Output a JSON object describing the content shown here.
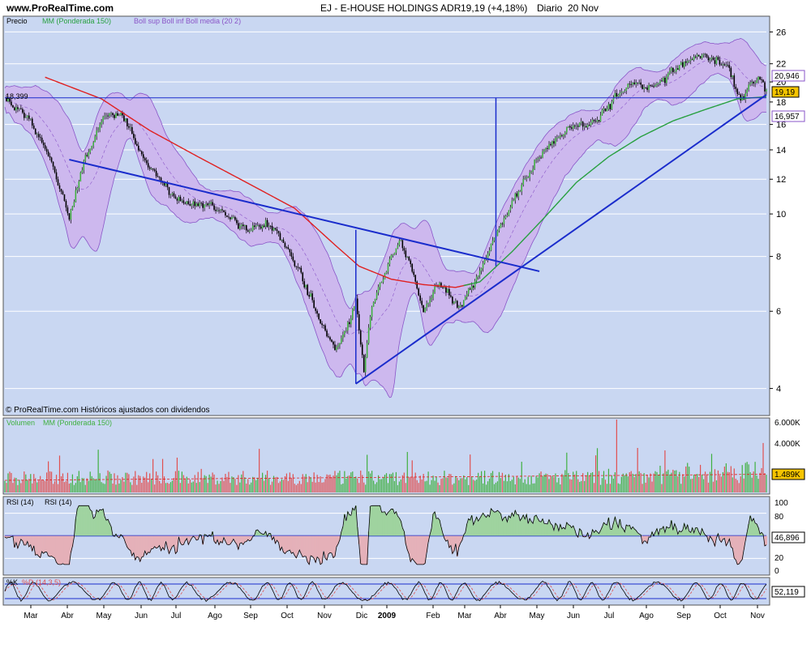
{
  "header": {
    "site": "www.ProRealTime.com",
    "title": "EJ - E-HOUSE HOLDINGS ADR",
    "quote": "19,19 (+4,18%)",
    "period": "Diario",
    "date": "20 Nov"
  },
  "colors": {
    "price_bg": "#c9d7f2",
    "panel_bg": "#c9d7f2",
    "boll_fill": "#cdb8ee",
    "boll_line": "#8a55c8",
    "ma_red": "#e02020",
    "ma_green": "#28a040",
    "trend": "#1a2ccc",
    "vol_green": "#40b040",
    "vol_red": "#e05050",
    "rsi_green": "#9fd39f",
    "rsi_red": "#e5b0b8"
  },
  "chart_data": [
    {
      "type": "line",
      "name": "price",
      "legend": [
        "Precio",
        "MM (Ponderada 150)",
        "Boll sup Boll inf Boll media (20 2)"
      ],
      "note": "© ProRealTime.com Históricos ajustados con dividendos",
      "scale": "log",
      "y_ticks": [
        4,
        6,
        8,
        10,
        12,
        14,
        16,
        18,
        20,
        22,
        26
      ],
      "ylim": [
        3.5,
        28
      ],
      "labels": {
        "boll_sup": "20,946",
        "last": "19,19",
        "boll_inf": "16,957",
        "level": "18,399"
      },
      "x_months": [
        "Mar",
        "Abr",
        "May",
        "Jun",
        "Jul",
        "Ago",
        "Sep",
        "Oct",
        "Nov",
        "Dic",
        "2009",
        "Feb",
        "Mar",
        "Abr",
        "May",
        "Jun",
        "Jul",
        "Ago",
        "Sep",
        "Oct",
        "Nov"
      ],
      "close_keypoints": [
        [
          0,
          18.3
        ],
        [
          15,
          16.5
        ],
        [
          28,
          13.5
        ],
        [
          40,
          9.8
        ],
        [
          50,
          13.5
        ],
        [
          60,
          16.2
        ],
        [
          65,
          17.0
        ],
        [
          75,
          16.4
        ],
        [
          85,
          13.5
        ],
        [
          100,
          11.5
        ],
        [
          112,
          10.5
        ],
        [
          125,
          10.6
        ],
        [
          140,
          9.8
        ],
        [
          150,
          9.2
        ],
        [
          165,
          9.5
        ],
        [
          180,
          7.8
        ],
        [
          195,
          5.8
        ],
        [
          205,
          4.9
        ],
        [
          212,
          5.5
        ],
        [
          218,
          6.3
        ],
        [
          223,
          4.4
        ],
        [
          228,
          6.2
        ],
        [
          238,
          7.6
        ],
        [
          245,
          8.7
        ],
        [
          252,
          7.7
        ],
        [
          260,
          6.0
        ],
        [
          270,
          7.0
        ],
        [
          282,
          6.1
        ],
        [
          295,
          7.4
        ],
        [
          305,
          9.0
        ],
        [
          320,
          11.5
        ],
        [
          335,
          14.0
        ],
        [
          350,
          15.8
        ],
        [
          365,
          16.0
        ],
        [
          380,
          18.5
        ],
        [
          390,
          20.0
        ],
        [
          400,
          19.4
        ],
        [
          410,
          20.5
        ],
        [
          420,
          21.8
        ],
        [
          430,
          23.0
        ],
        [
          440,
          22.5
        ],
        [
          450,
          21.5
        ],
        [
          457,
          18.0
        ],
        [
          463,
          20.0
        ],
        [
          468,
          20.5
        ],
        [
          473,
          19.19
        ]
      ],
      "ma150_keypoints": [
        [
          25,
          20.5
        ],
        [
          60,
          18.3
        ],
        [
          90,
          15.5
        ],
        [
          120,
          13.5
        ],
        [
          150,
          11.8
        ],
        [
          180,
          10.3
        ],
        [
          205,
          8.5
        ],
        [
          220,
          7.6
        ],
        [
          240,
          7.1
        ],
        [
          260,
          6.9
        ],
        [
          280,
          6.8
        ],
        [
          295,
          7.0
        ],
        [
          315,
          8.2
        ],
        [
          335,
          9.8
        ],
        [
          355,
          11.8
        ],
        [
          375,
          13.5
        ],
        [
          395,
          15.0
        ],
        [
          415,
          16.3
        ],
        [
          435,
          17.3
        ],
        [
          455,
          18.3
        ],
        [
          473,
          18.5
        ]
      ],
      "trendlines": [
        {
          "from": [
            40,
            13.3
          ],
          "to": [
            332,
            7.4
          ]
        },
        {
          "from": [
            218,
            4.1
          ],
          "to": [
            473,
            18.7
          ]
        }
      ],
      "hlines": [
        18.399
      ]
    },
    {
      "type": "bar",
      "name": "volume",
      "legend": [
        "Volumen",
        "MM (Ponderada 150)"
      ],
      "y_ticks": [
        "6.000K",
        "4.000K"
      ],
      "last_label": "1.489K"
    },
    {
      "type": "area",
      "name": "rsi",
      "legend": [
        "RSI (14)",
        "RSI (14)"
      ],
      "y_ticks": [
        100,
        80,
        20,
        0
      ],
      "last_label": "46,896"
    },
    {
      "type": "line",
      "name": "stochastic",
      "legend": [
        "%K",
        "%D (14,3,5)"
      ],
      "last_label": "52,119"
    }
  ]
}
